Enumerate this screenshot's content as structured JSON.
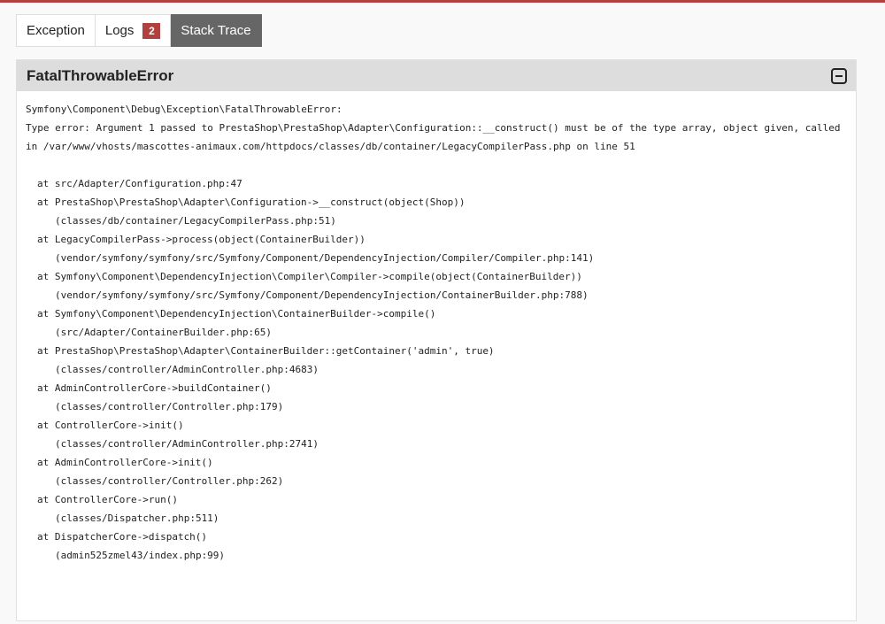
{
  "tabs": [
    {
      "label": "Exception",
      "active": false
    },
    {
      "label": "Logs",
      "active": false,
      "badge": "2"
    },
    {
      "label": "Stack Trace",
      "active": true
    }
  ],
  "panel": {
    "title": "FatalThrowableError",
    "toggle_icon": "collapse-minus-icon",
    "message_lines": [
      "Symfony\\Component\\Debug\\Exception\\FatalThrowableError:",
      "Type error: Argument 1 passed to PrestaShop\\PrestaShop\\Adapter\\Configuration::__construct() must be of the type array, object given, called",
      "in /var/www/vhosts/mascottes-animaux.com/httpdocs/classes/db/container/LegacyCompilerPass.php on line 51"
    ],
    "frames": [
      {
        "call": "at src/Adapter/Configuration.php:47",
        "file": ""
      },
      {
        "call": "at PrestaShop\\PrestaShop\\Adapter\\Configuration->__construct(object(Shop))",
        "file": "(classes/db/container/LegacyCompilerPass.php:51)"
      },
      {
        "call": "at LegacyCompilerPass->process(object(ContainerBuilder))",
        "file": "(vendor/symfony/symfony/src/Symfony/Component/DependencyInjection/Compiler/Compiler.php:141)"
      },
      {
        "call": "at Symfony\\Component\\DependencyInjection\\Compiler\\Compiler->compile(object(ContainerBuilder))",
        "file": "(vendor/symfony/symfony/src/Symfony/Component/DependencyInjection/ContainerBuilder.php:788)"
      },
      {
        "call": "at Symfony\\Component\\DependencyInjection\\ContainerBuilder->compile()",
        "file": "(src/Adapter/ContainerBuilder.php:65)"
      },
      {
        "call": "at PrestaShop\\PrestaShop\\Adapter\\ContainerBuilder::getContainer('admin', true)",
        "file": "(classes/controller/AdminController.php:4683)"
      },
      {
        "call": "at AdminControllerCore->buildContainer()",
        "file": "(classes/controller/Controller.php:179)"
      },
      {
        "call": "at ControllerCore->init()",
        "file": "(classes/controller/AdminController.php:2741)"
      },
      {
        "call": "at AdminControllerCore->init()",
        "file": "(classes/controller/Controller.php:262)"
      },
      {
        "call": "at ControllerCore->run()",
        "file": "(classes/Dispatcher.php:511)"
      },
      {
        "call": "at DispatcherCore->dispatch()",
        "file": "(admin525zmel43/index.php:99)"
      }
    ]
  },
  "colors": {
    "accent": "#b0413e",
    "active_tab": "#666666",
    "header_bg": "#dddddd"
  }
}
